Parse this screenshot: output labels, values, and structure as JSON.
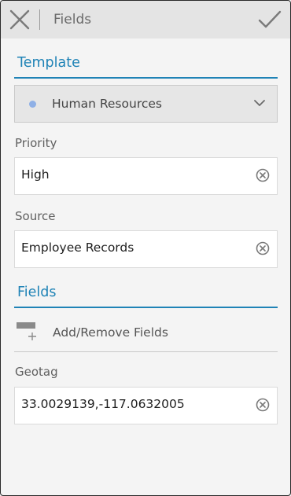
{
  "header": {
    "title": "Fields"
  },
  "template_section": {
    "heading": "Template",
    "selected": "Human Resources",
    "dot_color": "#8fb0e6"
  },
  "priority": {
    "label": "Priority",
    "value": "High"
  },
  "source": {
    "label": "Source",
    "value": "Employee Records"
  },
  "fields_section": {
    "heading": "Fields",
    "add_remove_label": "Add/Remove Fields"
  },
  "geotag": {
    "label": "Geotag",
    "value": "33.0029139,-117.0632005"
  },
  "colors": {
    "accent": "#1f83b6",
    "topbar": "#e4e4e4",
    "background": "#f4f4f4"
  },
  "icons": {
    "close": "close-icon",
    "confirm": "checkmark-icon",
    "dropdown": "chevron-down-icon",
    "clear": "clear-circle-x-icon",
    "add_fields": "add-fields-icon"
  }
}
